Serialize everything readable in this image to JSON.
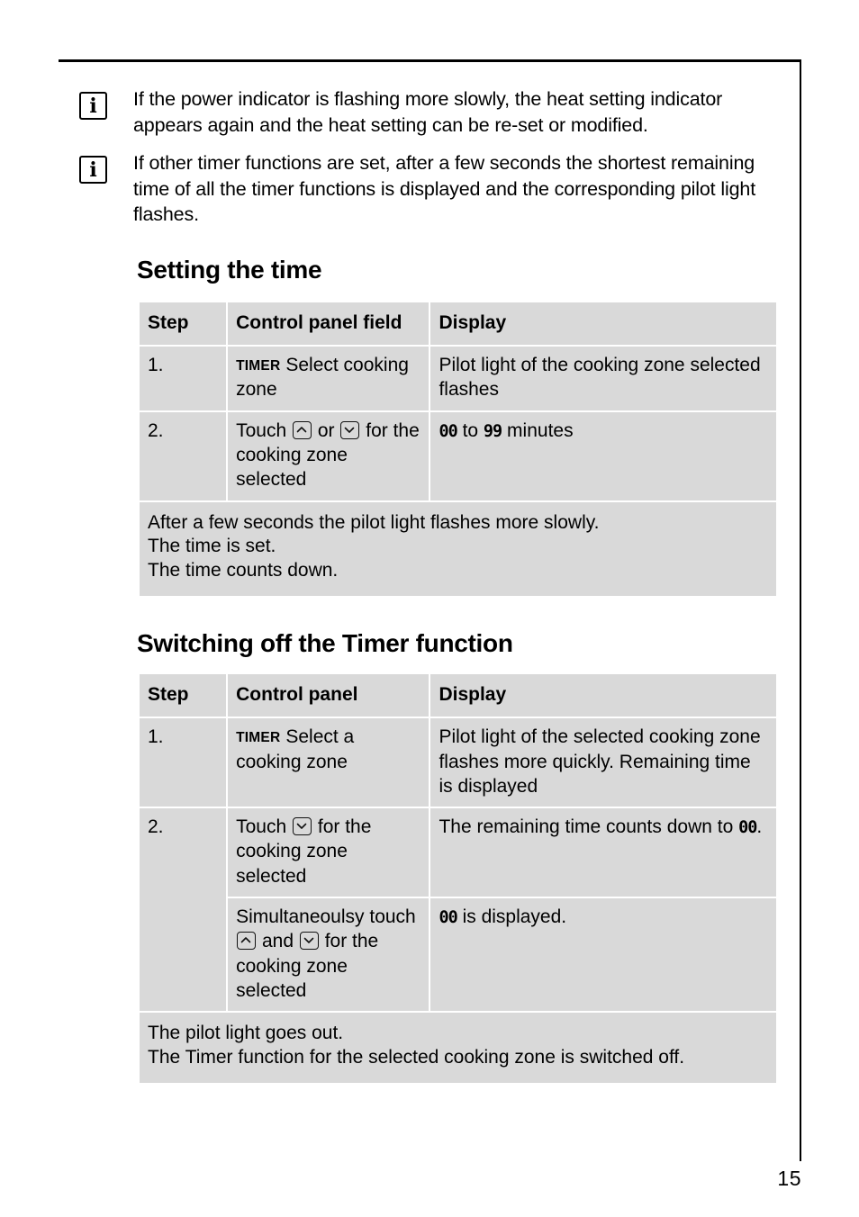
{
  "page": {
    "number": "15"
  },
  "notes": [
    {
      "icon": "info-icon",
      "text": "If the power indicator is flashing more slowly, the heat setting indicator appears again and the heat setting can be re-set or modified."
    },
    {
      "icon": "info-icon",
      "text": "If other timer functions are set, after a few seconds the shortest remaining time of all the timer functions is displayed and the corresponding pilot light flashes."
    }
  ],
  "sections": [
    {
      "heading": "Setting the time",
      "table": {
        "headers": [
          "Step",
          "Control panel field",
          "Display"
        ],
        "rows": [
          {
            "step": "1.",
            "panel_tag": "TIMER",
            "panel_text": "Select cooking zone",
            "display_text": "Pilot light of the cooking zone selected flashes"
          },
          {
            "step": "2.",
            "panel_prefix": "Touch",
            "panel_key1": "up-arrow",
            "panel_mid": "or",
            "panel_key2": "down-arrow",
            "panel_suffix": "for the cooking zone selected",
            "display_lcd1": "00",
            "display_mid": "to",
            "display_lcd2": "99",
            "display_suffix": "minutes"
          }
        ],
        "footer_lines": [
          "After a few seconds the pilot light flashes more slowly.",
          "The time is set.",
          "The time counts down."
        ]
      }
    },
    {
      "heading": "Switching off the Timer function",
      "table": {
        "headers": [
          "Step",
          "Control panel",
          "Display"
        ],
        "rows": [
          {
            "step": "1.",
            "panel_tag": "TIMER",
            "panel_text": "Select a cooking zone",
            "display_text": "Pilot light of the selected cooking zone flashes more quickly. Remaining time is displayed"
          },
          {
            "step": "2.",
            "panel_prefix": "Touch",
            "panel_key1": "down-arrow",
            "panel_suffix": "for the cooking zone selected",
            "display_prefix": "The remaining time counts down to",
            "display_lcd1": "00",
            "display_suffix": "."
          },
          {
            "step": "",
            "panel_prefix": "Simultaneoulsy touch",
            "panel_key1": "up-arrow",
            "panel_mid": "and",
            "panel_key2": "down-arrow",
            "panel_suffix": "for the cooking zone selected",
            "display_lcd1": "00",
            "display_suffix": "is displayed."
          }
        ],
        "footer_lines": [
          "The pilot light goes out.",
          "The Timer function for the selected cooking zone is switched off."
        ]
      }
    }
  ]
}
